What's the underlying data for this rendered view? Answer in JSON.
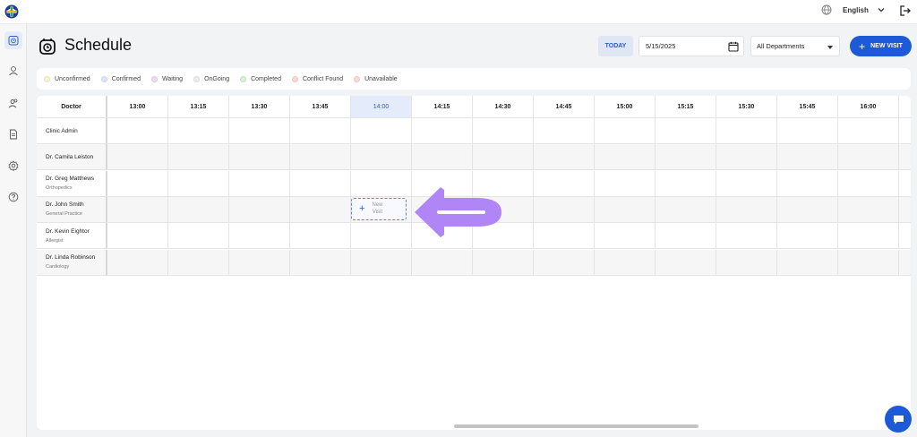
{
  "topbar": {
    "language": "English",
    "icons": {
      "logo": "plus-globe-logo",
      "globe": "globe-icon",
      "caret": "chevron-down-icon",
      "logout": "logout-icon"
    }
  },
  "rail": {
    "items": [
      {
        "icon": "calendar-clock-icon",
        "active": true
      },
      {
        "icon": "user-icon",
        "active": false
      },
      {
        "icon": "users-icon",
        "active": false
      },
      {
        "icon": "document-icon",
        "active": false
      },
      {
        "icon": "gear-icon",
        "active": false
      },
      {
        "icon": "help-icon",
        "active": false
      }
    ]
  },
  "header": {
    "title": "Schedule",
    "today_label": "TODAY",
    "date_value": "5/15/2025",
    "department_value": "All Departments",
    "new_visit_label": "NEW VISIT"
  },
  "legend": [
    {
      "label": "Unconfirmed",
      "color": "#fbf3d2"
    },
    {
      "label": "Confirmed",
      "color": "#dce6fb"
    },
    {
      "label": "Waiting",
      "color": "#e8dcf9"
    },
    {
      "label": "OnGoing",
      "color": "#ececec"
    },
    {
      "label": "Completed",
      "color": "#d8f1d8"
    },
    {
      "label": "Conflict Found",
      "color": "#fcd8d8"
    },
    {
      "label": "Unavailable",
      "color": "#fbdada"
    }
  ],
  "grid": {
    "doctor_header": "Doctor",
    "times": [
      "13:00",
      "13:15",
      "13:30",
      "13:45",
      "14:00",
      "14:15",
      "14:30",
      "14:45",
      "15:00",
      "15:15",
      "15:30",
      "15:45",
      "16:00"
    ],
    "active_time": "14:00",
    "doctors": [
      {
        "name": "Clinic Admin",
        "specialty": ""
      },
      {
        "name": "Dr. Camila Leiston",
        "specialty": ""
      },
      {
        "name": "Dr. Greg Matthews",
        "specialty": "Orthopedics"
      },
      {
        "name": "Dr. John Smith",
        "specialty": "General Practice"
      },
      {
        "name": "Dr. Kevin Eightor",
        "specialty": "Allergist"
      },
      {
        "name": "Dr. Linda Robinson",
        "specialty": "Cardiology"
      }
    ],
    "slot_visit": {
      "line1": "New",
      "line2": "Visit"
    }
  },
  "colors": {
    "accent": "#1c5ad8",
    "arrow": "#b085f5",
    "active_column": "#e4ecfb"
  }
}
